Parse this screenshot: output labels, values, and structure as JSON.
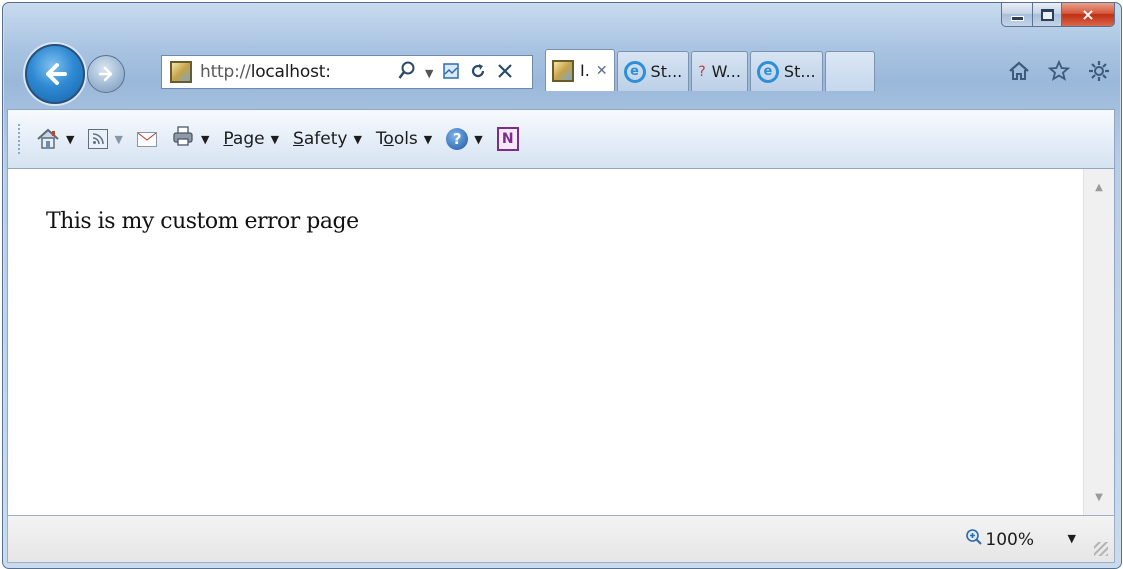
{
  "window": {
    "controls": {
      "minimize": "",
      "maximize": "",
      "close": "×"
    }
  },
  "nav": {
    "address_scheme": "http://",
    "address_host": "localhost:",
    "icons": [
      "back-arrow-icon",
      "forward-arrow-icon",
      "search-icon",
      "compatibility-view-icon",
      "refresh-icon",
      "stop-icon"
    ]
  },
  "tabs": [
    {
      "label": "I.",
      "icon": "page-favicon",
      "active": true
    },
    {
      "label": "St...",
      "icon": "ie-icon",
      "active": false
    },
    {
      "label": "W...",
      "icon": "question-favicon",
      "active": false
    },
    {
      "label": "St...",
      "icon": "ie-icon",
      "active": false
    }
  ],
  "toolbar_right": {
    "icons": [
      "home-icon",
      "favorites-star-icon",
      "tools-gear-icon"
    ]
  },
  "command_bar": {
    "page": {
      "pre": "",
      "underline": "P",
      "post": "age"
    },
    "safety": {
      "pre": "",
      "underline": "S",
      "post": "afety"
    },
    "tools": {
      "pre": "T",
      "underline": "o",
      "post": "ols"
    },
    "onenote_letter": "N"
  },
  "content": {
    "text": "This is my custom error page"
  },
  "status": {
    "zoom": "100%"
  },
  "colors": {
    "accent": "#2f8ad3",
    "close": "#c02f14",
    "frame": "#a9c4e2"
  }
}
